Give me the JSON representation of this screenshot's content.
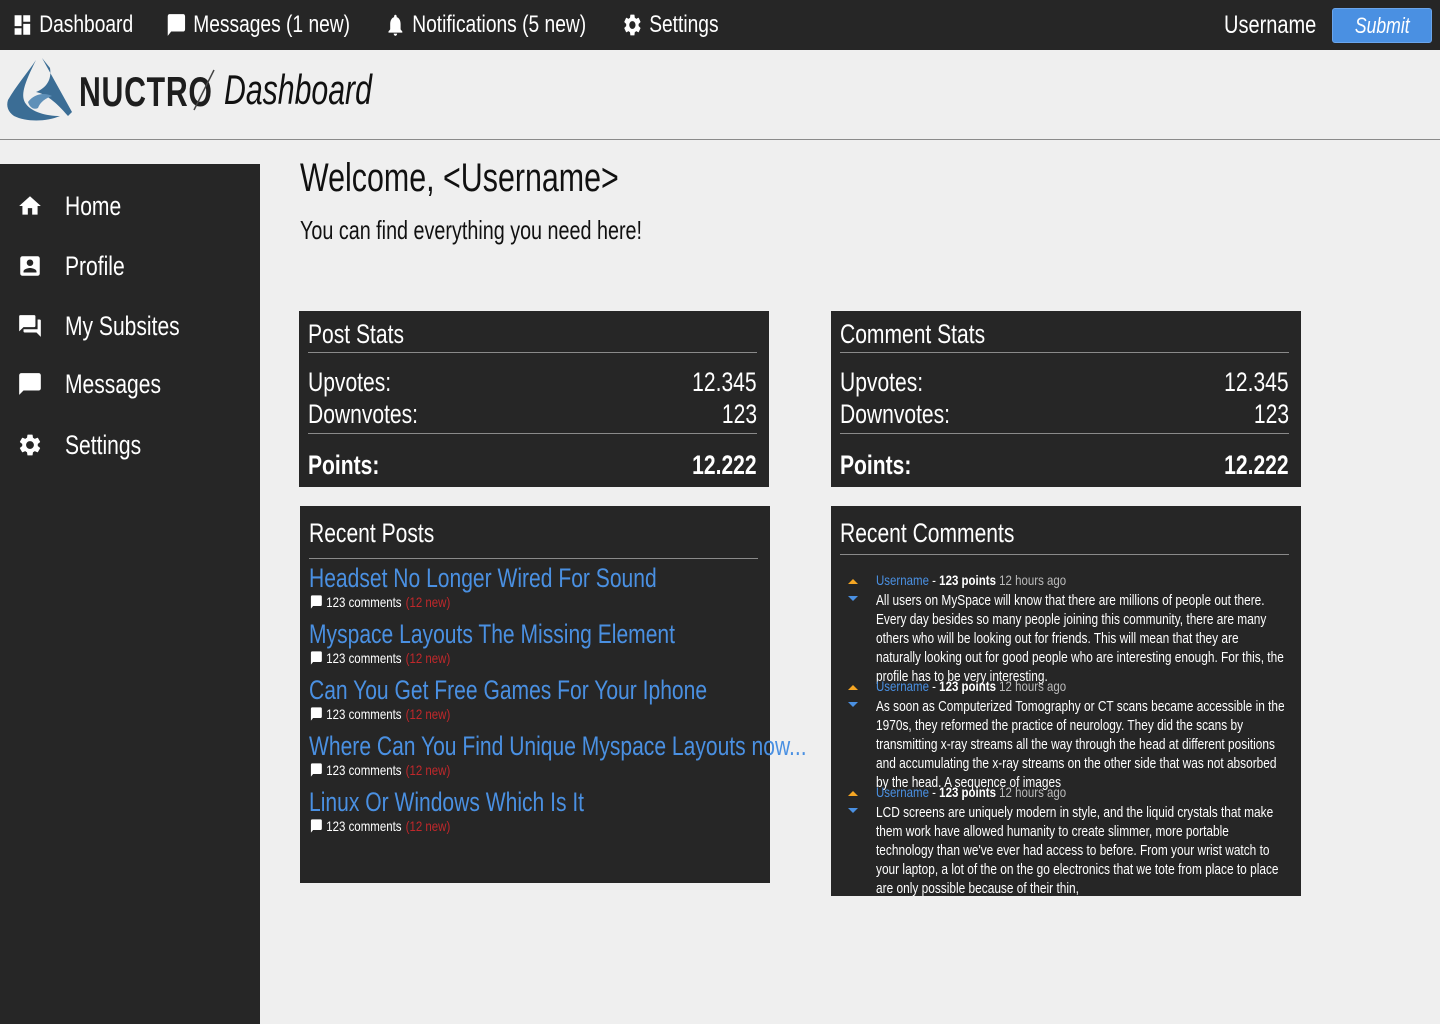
{
  "topbar": {
    "items": [
      {
        "label": "Dashboard",
        "icon": "dashboard-icon"
      },
      {
        "label": "Messages (1 new)",
        "icon": "message-icon"
      },
      {
        "label": "Notifications (5 new)",
        "icon": "bell-icon"
      },
      {
        "label": "Settings",
        "icon": "gear-icon"
      }
    ],
    "username": "Username",
    "submit_label": "Submit"
  },
  "header": {
    "brand": "NUCTRO",
    "page": "Dashboard"
  },
  "sidebar": {
    "items": [
      {
        "label": "Home",
        "icon": "home-icon"
      },
      {
        "label": "Profile",
        "icon": "profile-icon"
      },
      {
        "label": "My Subsites",
        "icon": "forum-icon"
      },
      {
        "label": "Messages",
        "icon": "message-icon"
      },
      {
        "label": "Settings",
        "icon": "gear-icon"
      }
    ]
  },
  "main": {
    "welcome": "Welcome, <Username>",
    "subtitle": "You can find everything you need here!"
  },
  "post_stats": {
    "title": "Post Stats",
    "upvotes_label": "Upvotes:",
    "upvotes": "12.345",
    "downvotes_label": "Downvotes:",
    "downvotes": "123",
    "points_label": "Points:",
    "points": "12.222"
  },
  "comment_stats": {
    "title": "Comment Stats",
    "upvotes_label": "Upvotes:",
    "upvotes": "12.345",
    "downvotes_label": "Downvotes:",
    "downvotes": "123",
    "points_label": "Points:",
    "points": "12.222"
  },
  "recent_posts": {
    "title": "Recent Posts",
    "items": [
      {
        "title": "Headset No Longer Wired For Sound",
        "comments": "123 comments",
        "new": "(12 new)"
      },
      {
        "title": "Myspace Layouts The Missing Element",
        "comments": "123 comments",
        "new": "(12 new)"
      },
      {
        "title": "Can You Get Free Games For Your Iphone",
        "comments": "123 comments",
        "new": "(12 new)"
      },
      {
        "title": "Where Can You Find Unique Myspace Layouts now...",
        "comments": "123 comments",
        "new": "(12 new)"
      },
      {
        "title": "Linux Or Windows Which Is It",
        "comments": "123 comments",
        "new": "(12 new)"
      }
    ]
  },
  "recent_comments": {
    "title": "Recent Comments",
    "items": [
      {
        "user": "Username",
        "sep": " - ",
        "points": "123 points",
        "ago": "12 hours ago",
        "text": "All users on MySpace will know that there are millions of people out there. Every day besides so many people joining this community, there are many others who will be looking out for friends. This will mean that they are naturally looking out for good people who are interesting enough. For this, the profile has to be very interesting."
      },
      {
        "user": "Username",
        "sep": " - ",
        "points": "123 points",
        "ago": "12 hours ago",
        "text": "As soon as Computerized Tomography or CT scans became accessible in the 1970s, they reformed the practice of neurology. They did the scans by transmitting x-ray streams all the way through the head at different positions and accumulating the x-ray streams on the other side that was not absorbed by the head. A sequence of images"
      },
      {
        "user": "Username",
        "sep": " - ",
        "points": "123 points",
        "ago": "12 hours ago",
        "text": "LCD screens are uniquely modern in style, and the liquid crystals that make them work have allowed humanity to create slimmer, more portable technology than we've ever had access to before. From your wrist watch to your laptop, a lot of the on the go electronics that we tote from place to place are only possible because of their thin,"
      }
    ]
  },
  "colors": {
    "dark": "#262626",
    "link": "#4a90e2",
    "new": "#c0282b",
    "upvote": "#f5a623",
    "downvote": "#4a90e2",
    "logo": "#3b6d95"
  }
}
